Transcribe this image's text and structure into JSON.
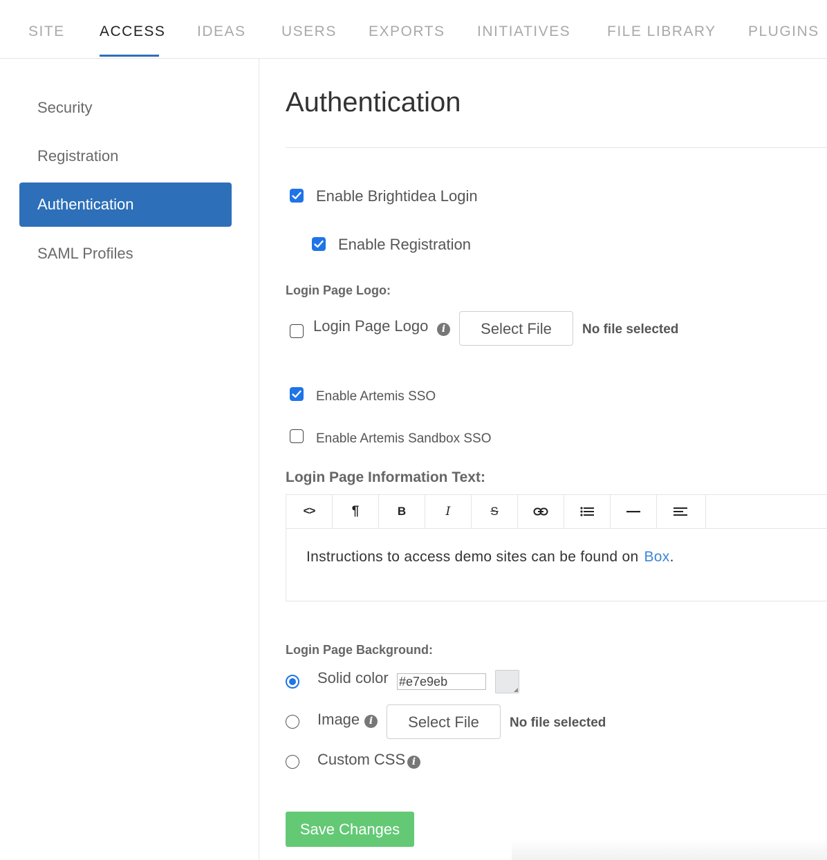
{
  "top_tabs": [
    {
      "label": "SITE"
    },
    {
      "label": "ACCESS",
      "active": true
    },
    {
      "label": "IDEAS"
    },
    {
      "label": "USERS"
    },
    {
      "label": "EXPORTS"
    },
    {
      "label": "INITIATIVES"
    },
    {
      "label": "FILE LIBRARY"
    },
    {
      "label": "PLUGINS"
    }
  ],
  "sidebar": {
    "items": [
      {
        "label": "Security"
      },
      {
        "label": "Registration"
      },
      {
        "label": "Authentication",
        "active": true
      },
      {
        "label": "SAML Profiles"
      }
    ]
  },
  "main": {
    "title": "Authentication",
    "enable_brightidea_login": {
      "label": "Enable Brightidea Login",
      "checked": true
    },
    "enable_registration": {
      "label": "Enable Registration",
      "checked": true
    },
    "login_page_logo": {
      "section_label": "Login Page Logo:",
      "checkbox_label": "Login Page Logo",
      "checked": false,
      "select_file_label": "Select File",
      "file_status": "No file selected"
    },
    "enable_artemis_sso": {
      "label": "Enable Artemis SSO",
      "checked": true
    },
    "enable_artemis_sandbox_sso": {
      "label": "Enable Artemis Sandbox SSO",
      "checked": false
    },
    "info_text": {
      "section_label": "Login Page Information Text:",
      "toolbar": [
        "code-view",
        "paragraph",
        "bold",
        "italic",
        "strikethrough",
        "link",
        "list",
        "horizontal-rule",
        "align"
      ],
      "bold_glyph": "B",
      "italic_glyph": "I",
      "paragraph_glyph": "¶",
      "code_glyph": "<>",
      "strike_glyph": "S",
      "content_text": "Instructions to access demo sites can be found on",
      "content_link": "Box",
      "content_end": "."
    },
    "background": {
      "section_label": "Login Page Background:",
      "solid_color_label": "Solid color",
      "solid_color_value": "#e7e9eb",
      "swatch_color": "#e7e9eb",
      "image_label": "Image",
      "image_select_file_label": "Select File",
      "image_file_status": "No file selected",
      "custom_css_label": "Custom CSS",
      "selected": "solid_color"
    },
    "save_label": "Save Changes"
  },
  "colors": {
    "accent": "#2d6fb8",
    "checkbox": "#1f74e8",
    "save": "#63c975",
    "link": "#3a86d8"
  }
}
